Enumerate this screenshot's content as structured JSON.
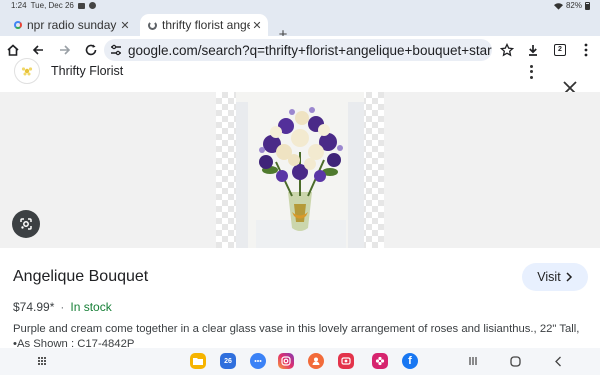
{
  "status": {
    "time": "1:24",
    "date": "Tue, Dec 26",
    "battery": "82%"
  },
  "tabs": [
    {
      "title": "npr radio sunday m",
      "active": false
    },
    {
      "title": "thrifty florist angel",
      "active": true
    }
  ],
  "toolbar": {
    "url": "google.com/search?q=thrifty+florist+angelique+bouquet+star",
    "tab_count": "2"
  },
  "merchant": {
    "name": "Thrifty Florist"
  },
  "product": {
    "title": "Angelique Bouquet",
    "price": "$74.99*",
    "stock": "In stock",
    "description": "Purple and cream come together in a clear glass vase in this lovely arrangement of roses and lisianthus., 22\" Tall, •As Shown : C17-4842P"
  },
  "actions": {
    "visit_label": "Visit"
  },
  "colors": {
    "chrome_bg": "#e3e9f2",
    "visit_bg": "#e8f0fe",
    "stock_green": "#188038"
  },
  "icons": {
    "dock_apps": [
      "files-icon",
      "calendar-icon",
      "messages-icon",
      "instagram-icon",
      "contacts-icon",
      "screen-recorder-icon",
      "flower-app-icon",
      "facebook-icon"
    ]
  },
  "dock": {
    "calendar_day": "26"
  }
}
